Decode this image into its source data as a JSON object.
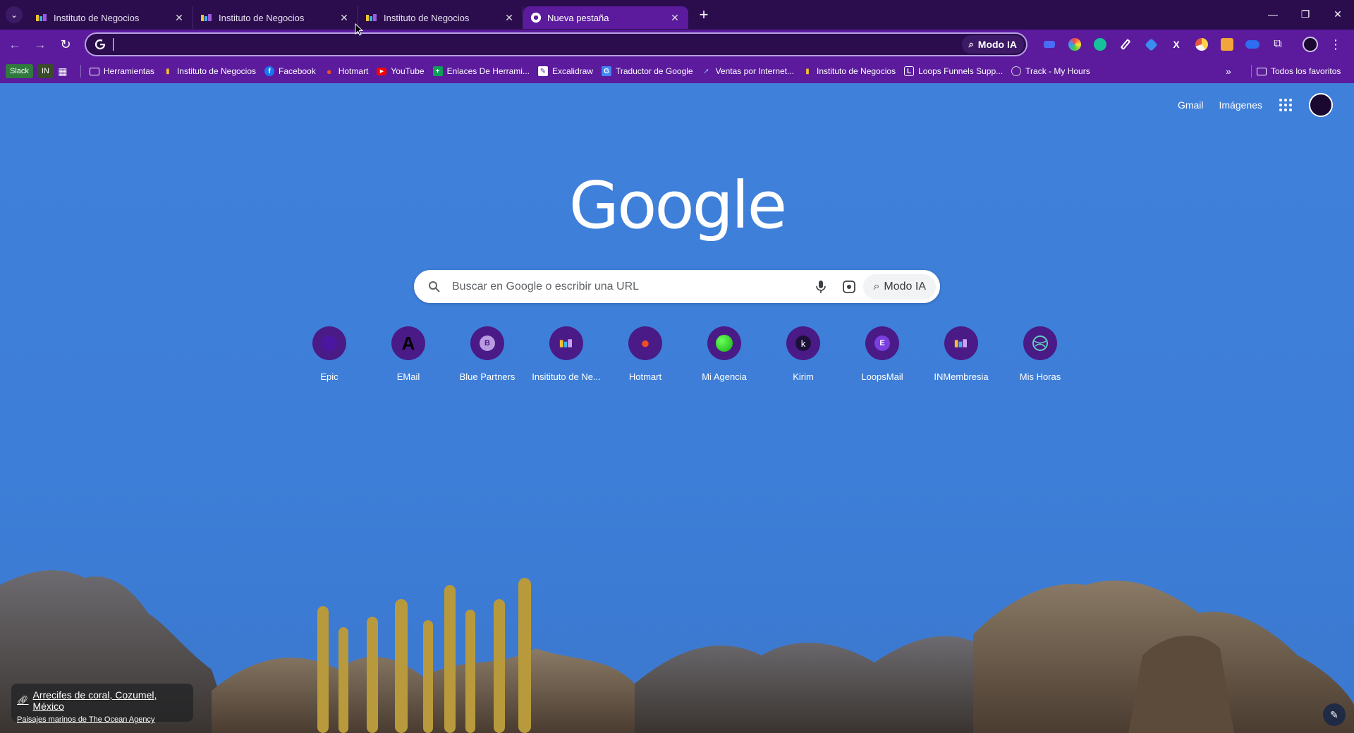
{
  "colors": {
    "tabstrip": "#2b0d4e",
    "toolbar": "#5b1b9c",
    "ntp_background": "#3f7fd8",
    "shortcut_circle": "#4a1a86"
  },
  "tabs": [
    {
      "title": "Instituto de Negocios",
      "icon": "instituto-favicon",
      "active": false
    },
    {
      "title": "Instituto de Negocios",
      "icon": "instituto-favicon",
      "active": false
    },
    {
      "title": "Instituto de Negocios",
      "icon": "instituto-favicon",
      "active": false
    },
    {
      "title": "Nueva pestaña",
      "icon": "chrome-icon",
      "active": true
    }
  ],
  "toolbar": {
    "ai_mode_label": "Modo IA",
    "address_value": ""
  },
  "bookmarks": {
    "chips": [
      "Slack",
      "IN"
    ],
    "items": [
      {
        "label": "Herramientas",
        "icon": "folder-icon"
      },
      {
        "label": "Instituto de Negocios",
        "icon": "instituto-favicon"
      },
      {
        "label": "Facebook",
        "icon": "facebook-icon"
      },
      {
        "label": "Hotmart",
        "icon": "hotmart-icon"
      },
      {
        "label": "YouTube",
        "icon": "youtube-icon"
      },
      {
        "label": "Enlaces De Herrami...",
        "icon": "sheets-icon"
      },
      {
        "label": "Excalidraw",
        "icon": "excalidraw-icon"
      },
      {
        "label": "Traductor de Google",
        "icon": "translate-icon"
      },
      {
        "label": "Ventas por Internet...",
        "icon": "ventas-icon"
      },
      {
        "label": "Instituto de Negocios",
        "icon": "instituto-favicon"
      },
      {
        "label": "Loops Funnels Supp...",
        "icon": "loops-icon"
      },
      {
        "label": "Track - My Hours",
        "icon": "myhours-icon"
      }
    ],
    "all_bookmarks_label": "Todos los favoritos"
  },
  "ntp": {
    "top_links": {
      "gmail": "Gmail",
      "images": "Imágenes"
    },
    "logo": "Google",
    "search": {
      "placeholder": "Buscar en Google o escribir una URL",
      "ai_mode_label": "Modo IA"
    },
    "shortcuts": [
      {
        "label": "Epic",
        "icon": "epic-icon"
      },
      {
        "label": "EMail",
        "icon": "email-a-icon"
      },
      {
        "label": "Blue Partners",
        "icon": "blue-partners-icon"
      },
      {
        "label": "Insitituto de Ne...",
        "icon": "instituto-favicon"
      },
      {
        "label": "Hotmart",
        "icon": "hotmart-icon"
      },
      {
        "label": "Mi Agencia",
        "icon": "green-dot-icon"
      },
      {
        "label": "Kirim",
        "icon": "kirim-icon"
      },
      {
        "label": "LoopsMail",
        "icon": "loopsmail-icon"
      },
      {
        "label": "INMembresia",
        "icon": "instituto-favicon"
      },
      {
        "label": "Mis Horas",
        "icon": "globe-icon"
      }
    ],
    "background_credit": {
      "title": "Arrecifes de coral, Cozumel, México",
      "subtitle": "Paisajes marinos de The Ocean Agency"
    }
  }
}
